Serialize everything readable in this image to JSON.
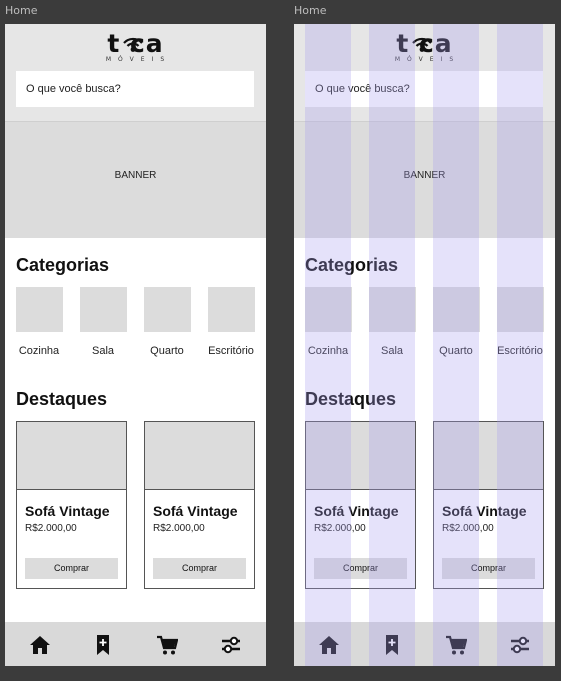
{
  "frames": [
    {
      "label": "Home"
    },
    {
      "label": "Home"
    }
  ],
  "logo": {
    "word": "t  ca",
    "sub": "MÓVEIS"
  },
  "search": {
    "placeholder": "O que você busca?"
  },
  "banner": {
    "label": "BANNER"
  },
  "categories": {
    "title": "Categorias",
    "items": [
      "Cozinha",
      "Sala",
      "Quarto",
      "Escritório"
    ]
  },
  "highlights": {
    "title": "Destaques",
    "products": [
      {
        "name": "Sofá Vintage",
        "price": "R$2.000,00",
        "button": "Comprar"
      },
      {
        "name": "Sofá Vintage",
        "price": "R$2.000,00",
        "button": "Comprar"
      }
    ]
  },
  "nav": {
    "icons": [
      "home-icon",
      "bookmark-add-icon",
      "cart-icon",
      "filter-sliders-icon"
    ]
  },
  "colors": {
    "background": "#3b3b3b",
    "header": "#e6e6e6",
    "placeholder_box": "#dcdcdc",
    "grid_overlay": "#aaa0f0"
  }
}
